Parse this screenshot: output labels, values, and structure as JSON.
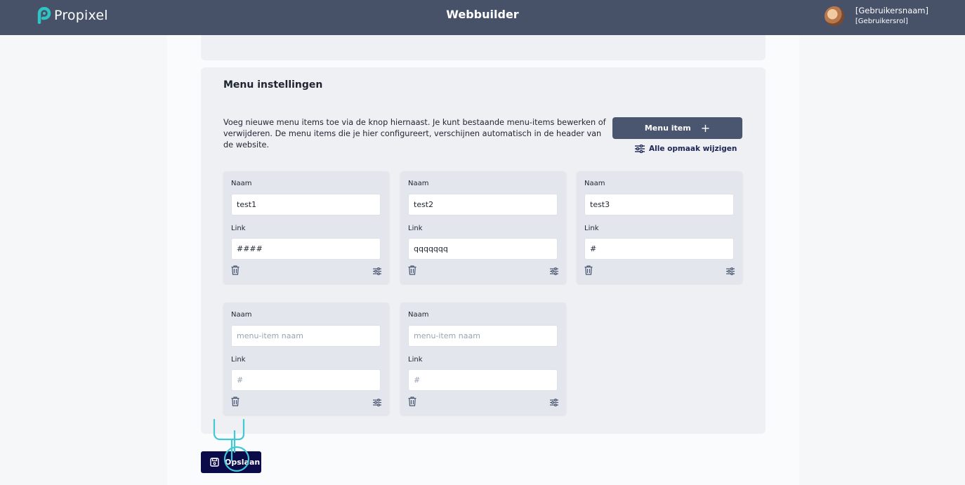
{
  "header": {
    "logo_text": "Propixel",
    "app_title": "Webbuilder",
    "user_name": "[Gebruikersnaam]",
    "user_role": "[Gebruikersrol]"
  },
  "menu_settings": {
    "title": "Menu instellingen",
    "description": "Voeg nieuwe menu items toe via de knop hiernaast. Je kunt bestaande menu-items bewerken of verwijderen. De menu items die je hier configureert, verschijnen automatisch in de header van de website.",
    "add_button_label": "Menu item",
    "add_button_icon": "plus-icon",
    "style_link_label": "Alle opmaak wijzigen",
    "style_link_icon": "sliders-icon"
  },
  "menu_items": [
    {
      "name_label": "Naam",
      "name_value": "test1",
      "name_placeholder": "menu-item naam",
      "link_label": "Link",
      "link_value": "####",
      "link_placeholder": "#"
    },
    {
      "name_label": "Naam",
      "name_value": "test2",
      "name_placeholder": "menu-item naam",
      "link_label": "Link",
      "link_value": "qqqqqqq",
      "link_placeholder": "#"
    },
    {
      "name_label": "Naam",
      "name_value": "test3",
      "name_placeholder": "menu-item naam",
      "link_label": "Link",
      "link_value": "#",
      "link_placeholder": "#"
    },
    {
      "name_label": "Naam",
      "name_value": "",
      "name_placeholder": "menu-item naam",
      "link_label": "Link",
      "link_value": "",
      "link_placeholder": "#"
    },
    {
      "name_label": "Naam",
      "name_value": "",
      "name_placeholder": "menu-item naam",
      "link_label": "Link",
      "link_value": "",
      "link_placeholder": "#"
    }
  ],
  "save_button": {
    "label": "Opslaan",
    "icon": "floppy-disk-icon"
  },
  "colors": {
    "header_bg": "#475269",
    "logo_accent": "#2ec4c4",
    "primary_button": "#4a5670",
    "save_button": "#0b0b4a",
    "panel_bg": "#eef0f4",
    "card_bg": "#e3e6ec"
  }
}
